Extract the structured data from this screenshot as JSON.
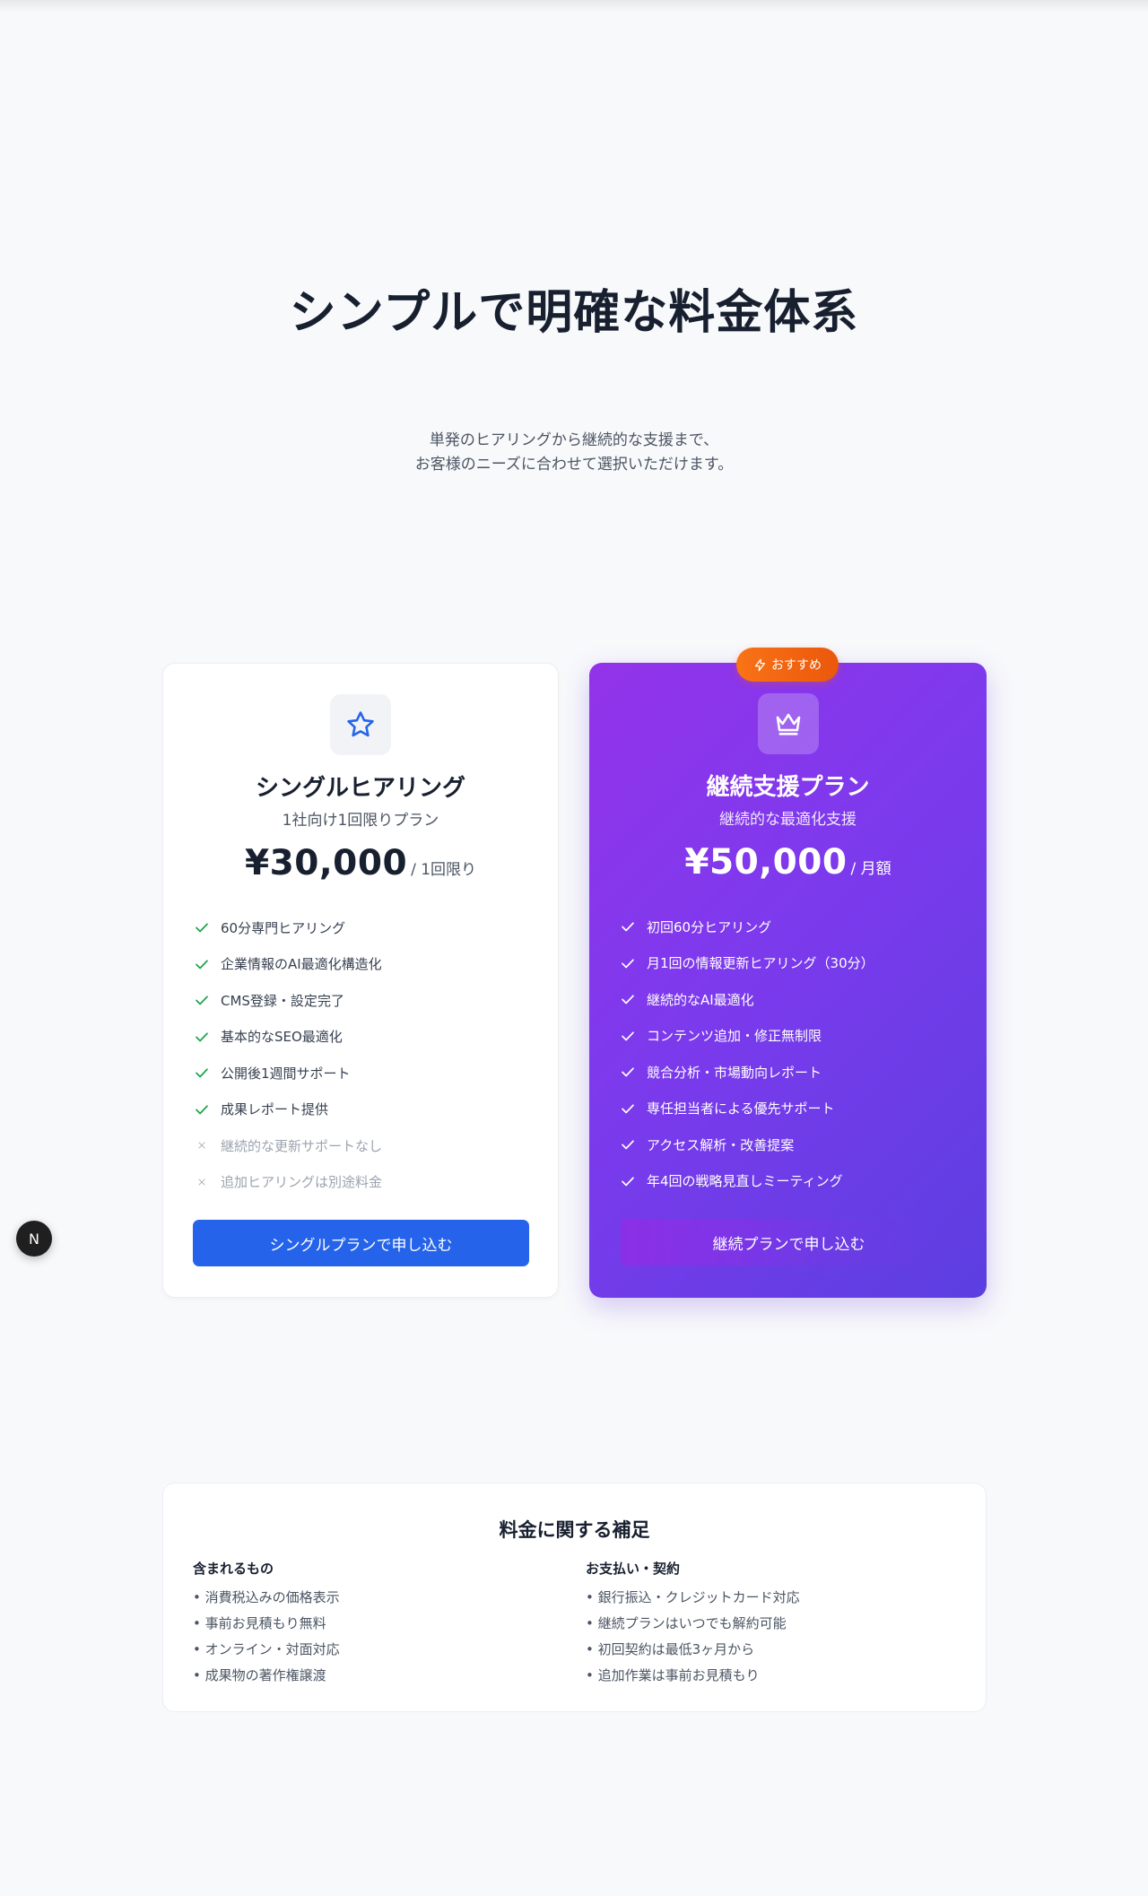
{
  "hero": {
    "title": "シンプルで明確な料金体系",
    "subtitle_line1": "単発のヒアリングから継続的な支援まで、",
    "subtitle_line2": "お客様のニーズに合わせて選択いただけます。"
  },
  "plans": [
    {
      "icon": "star-icon",
      "name": "シングルヒアリング",
      "tagline": "1社向け1回限りプラン",
      "price": "¥30,000",
      "price_unit": "/ 1回限り",
      "features": [
        {
          "text": "60分専門ヒアリング",
          "included": true
        },
        {
          "text": "企業情報のAI最適化構造化",
          "included": true
        },
        {
          "text": "CMS登録・設定完了",
          "included": true
        },
        {
          "text": "基本的なSEO最適化",
          "included": true
        },
        {
          "text": "公開後1週間サポート",
          "included": true
        },
        {
          "text": "成果レポート提供",
          "included": true
        },
        {
          "text": "継続的な更新サポートなし",
          "included": false
        },
        {
          "text": "追加ヒアリングは別途料金",
          "included": false
        }
      ],
      "cta": "シングルプランで申し込む",
      "accent": "#2563eb"
    },
    {
      "badge": "おすすめ",
      "icon": "crown-icon",
      "name": "継続支援プラン",
      "tagline": "継続的な最適化支援",
      "price": "¥50,000",
      "price_unit": "/ 月額",
      "features": [
        {
          "text": "初回60分ヒアリング",
          "included": true
        },
        {
          "text": "月1回の情報更新ヒアリング（30分）",
          "included": true
        },
        {
          "text": "継続的なAI最適化",
          "included": true
        },
        {
          "text": "コンテンツ追加・修正無制限",
          "included": true
        },
        {
          "text": "競合分析・市場動向レポート",
          "included": true
        },
        {
          "text": "専任担当者による優先サポート",
          "included": true
        },
        {
          "text": "アクセス解析・改善提案",
          "included": true
        },
        {
          "text": "年4回の戦略見直しミーティング",
          "included": true
        }
      ],
      "cta": "継続プランで申し込む",
      "accent": "#7c3aed"
    }
  ],
  "notes": {
    "title": "料金に関する補足",
    "included": {
      "heading": "含まれるもの",
      "items": [
        "• 消費税込みの価格表示",
        "• 事前お見積もり無料",
        "• オンライン・対面対応",
        "• 成果物の著作権譲渡"
      ]
    },
    "payment": {
      "heading": "お支払い・契約",
      "items": [
        "• 銀行振込・クレジットカード対応",
        "• 継続プランはいつでも解約可能",
        "• 初回契約は最低3ヶ月から",
        "• 追加作業は事前お見積もり"
      ]
    }
  },
  "fab": {
    "label": "N"
  }
}
